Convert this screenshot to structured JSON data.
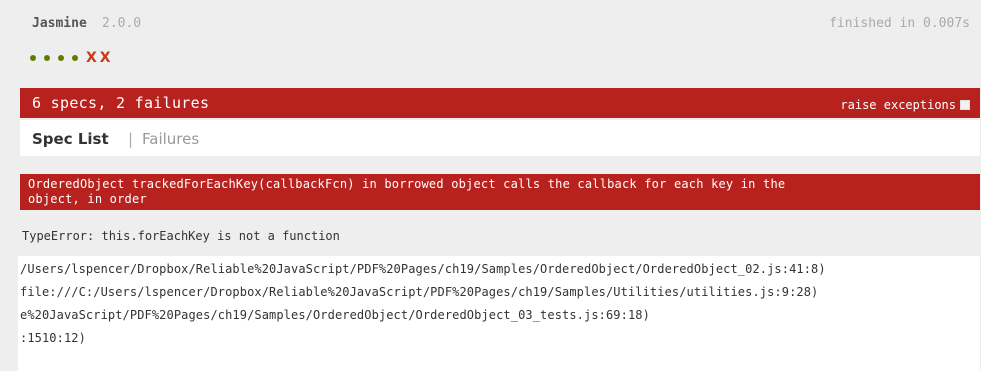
{
  "banner": {
    "title": "Jasmine",
    "version": "2.0.0",
    "duration": "finished in 0.007s"
  },
  "symbol_summary": {
    "results": [
      "passed",
      "passed",
      "passed",
      "passed",
      "failed",
      "failed"
    ],
    "failed_glyph": "X",
    "colors": {
      "passed": "#5e7d00",
      "failed": "#ca3a11"
    }
  },
  "alert": {
    "summary": "6 specs, 2 failures",
    "raise_exceptions_label": "raise exceptions",
    "raise_exceptions_checked": false,
    "bar_color": "#b8221e"
  },
  "menu": {
    "spec_list_label": "Spec List",
    "separator": "|",
    "failures_label": "Failures"
  },
  "failure": {
    "description_line1": "OrderedObject trackedForEachKey(callbackFcn) in borrowed object calls the callback for each key in the",
    "description_line2": "object, in order",
    "result_message": "TypeError: this.forEachKey is not a function",
    "stack_lines": [
      "/Users/lspencer/Dropbox/Reliable%20JavaScript/PDF%20Pages/ch19/Samples/OrderedObject/OrderedObject_02.js:41:8)",
      "file:///C:/Users/lspencer/Dropbox/Reliable%20JavaScript/PDF%20Pages/ch19/Samples/Utilities/utilities.js:9:28)",
      "e%20JavaScript/PDF%20Pages/ch19/Samples/OrderedObject/OrderedObject_03_tests.js:69:18)",
      ":1510:12)"
    ]
  }
}
